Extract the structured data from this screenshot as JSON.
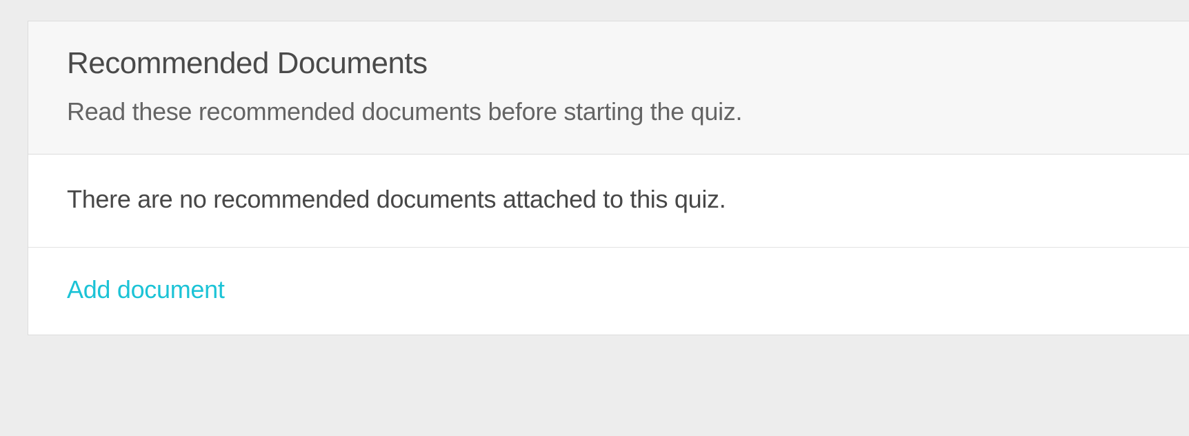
{
  "panel": {
    "title": "Recommended Documents",
    "subtitle": "Read these recommended documents before starting the quiz.",
    "empty_message": "There are no recommended documents attached to this quiz.",
    "add_button_label": "Add document"
  }
}
